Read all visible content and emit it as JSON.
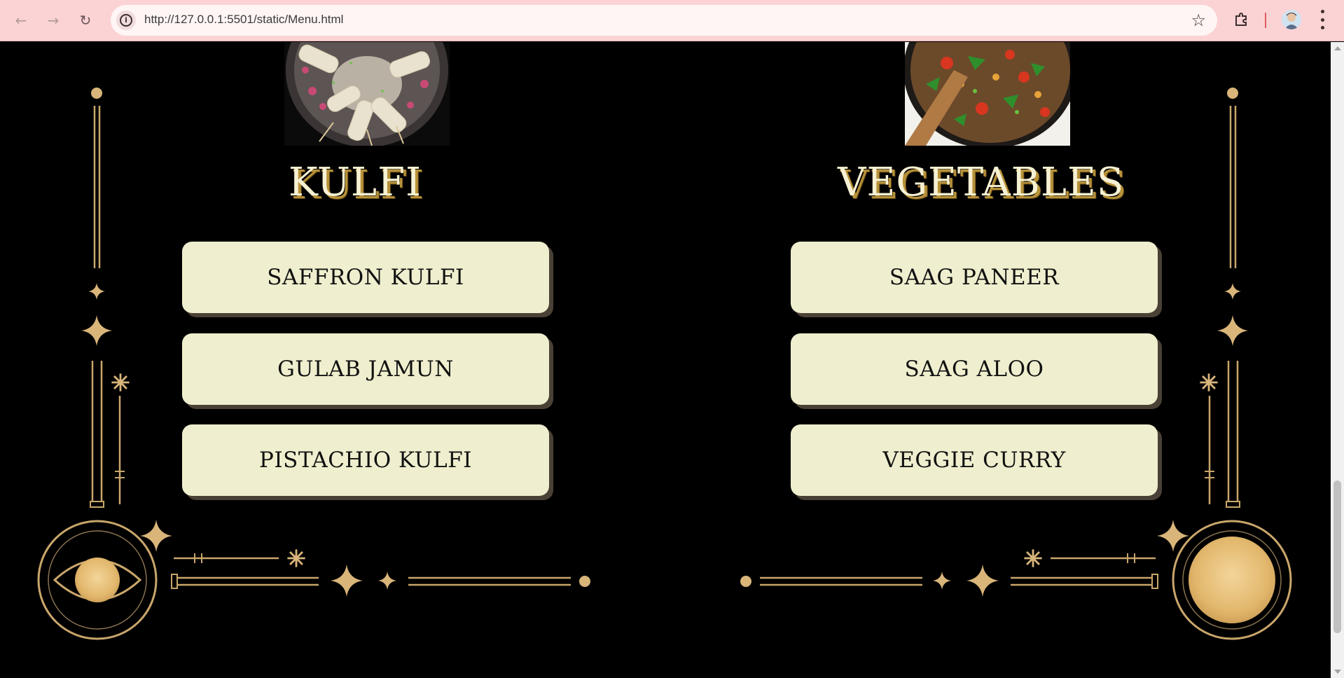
{
  "browser": {
    "url": "http://127.0.0.1:5501/static/Menu.html",
    "back_icon": "back-arrow-icon",
    "forward_icon": "forward-arrow-icon",
    "reload_icon": "reload-icon"
  },
  "colors": {
    "background": "#000000",
    "gold": "#d9b57a",
    "button_fill": "#efefcf",
    "title_text": "#f6f1d3",
    "title_shadow": "#b8923a",
    "chrome": "#fbd3d5"
  },
  "sections": [
    {
      "title": "KULFI",
      "image": "kulfi-photo",
      "items": [
        "SAFFRON KULFI",
        "GULAB JAMUN",
        "PISTACHIO KULFI"
      ]
    },
    {
      "title": "VEGETABLES",
      "image": "vegetables-photo",
      "items": [
        "SAAG PANEER",
        "SAAG ALOO",
        "VEGGIE CURRY"
      ]
    }
  ]
}
